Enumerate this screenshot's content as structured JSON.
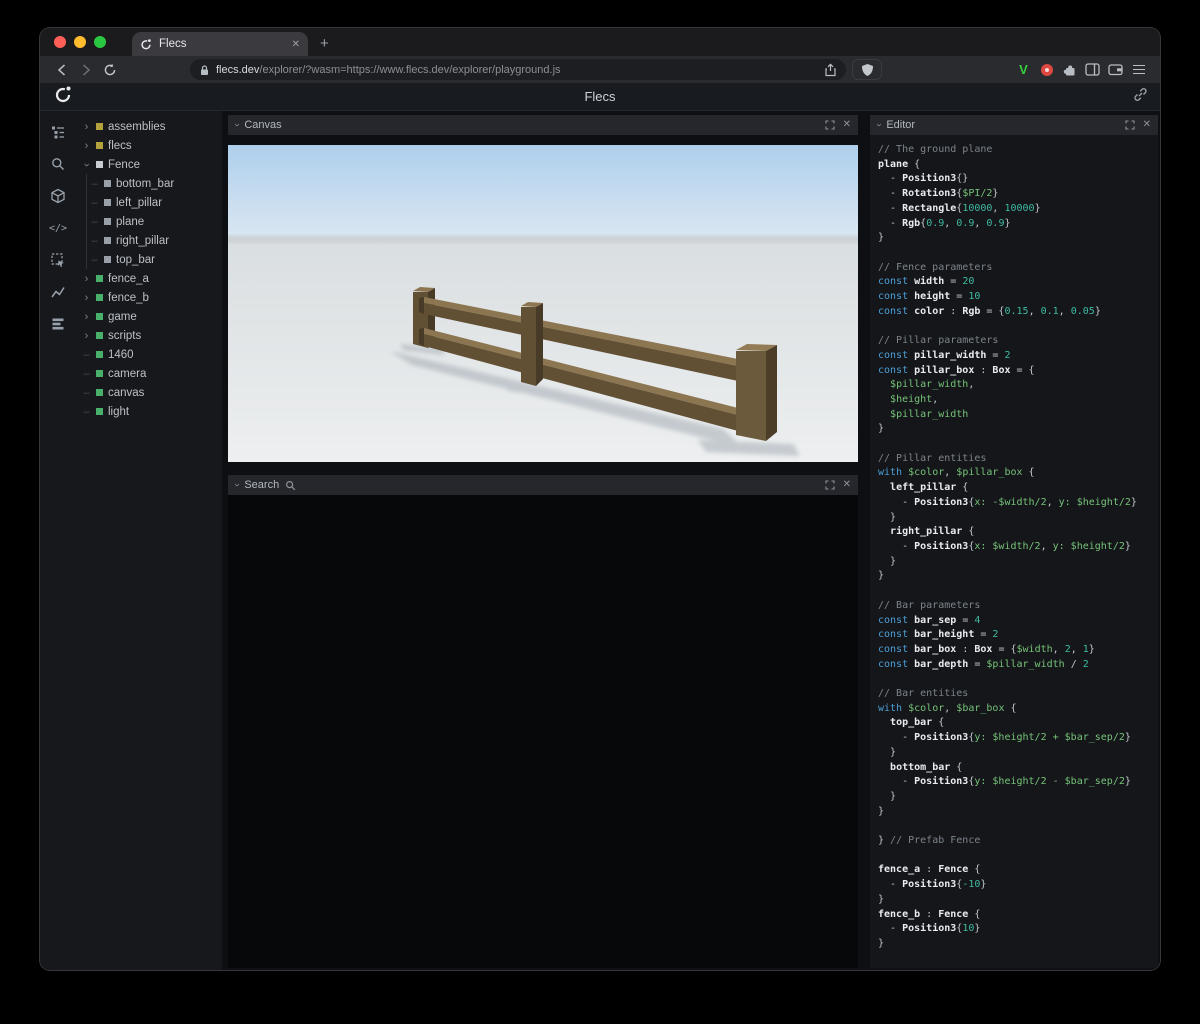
{
  "browser": {
    "tab_title": "Flecs",
    "new_tab_label": "+",
    "url_domain": "flecs.dev",
    "url_path": "/explorer/?wasm=https://www.flecs.dev/explorer/playground.js"
  },
  "header": {
    "title": "Flecs"
  },
  "panels": {
    "canvas_title": "Canvas",
    "search_title": "Search",
    "editor_title": "Editor"
  },
  "tree": {
    "items": [
      {
        "label": "assemblies",
        "sq": "#b3a23c",
        "arrow": "right",
        "depth": 0
      },
      {
        "label": "flecs",
        "sq": "#b3a23c",
        "arrow": "right",
        "depth": 0
      },
      {
        "label": "Fence",
        "sq": "#c9cdd3",
        "arrow": "down",
        "depth": 0
      },
      {
        "label": "bottom_bar",
        "sq": "#99a0a8",
        "arrow": "none",
        "depth": 1
      },
      {
        "label": "left_pillar",
        "sq": "#99a0a8",
        "arrow": "none",
        "depth": 1
      },
      {
        "label": "plane",
        "sq": "#99a0a8",
        "arrow": "none",
        "depth": 1
      },
      {
        "label": "right_pillar",
        "sq": "#99a0a8",
        "arrow": "none",
        "depth": 1
      },
      {
        "label": "top_bar",
        "sq": "#99a0a8",
        "arrow": "none",
        "depth": 1
      },
      {
        "label": "fence_a",
        "sq": "#48b06a",
        "arrow": "right",
        "depth": 0
      },
      {
        "label": "fence_b",
        "sq": "#48b06a",
        "arrow": "right",
        "depth": 0
      },
      {
        "label": "game",
        "sq": "#48b06a",
        "arrow": "right",
        "depth": 0
      },
      {
        "label": "scripts",
        "sq": "#48b06a",
        "arrow": "right",
        "depth": 0
      },
      {
        "label": "1460",
        "sq": "#48b06a",
        "arrow": "none",
        "depth": 0
      },
      {
        "label": "camera",
        "sq": "#48b06a",
        "arrow": "none",
        "depth": 0
      },
      {
        "label": "canvas",
        "sq": "#48b06a",
        "arrow": "none",
        "depth": 0
      },
      {
        "label": "light",
        "sq": "#48b06a",
        "arrow": "none",
        "depth": 0
      }
    ]
  },
  "scene": {
    "sky_top": "#aecfec",
    "sky_bottom": "#dce8f2",
    "ground_top": "#d9dee0",
    "ground_bottom": "#edeff0",
    "horizon": "#c6cdd2",
    "shadow": "#96a0a9",
    "wood_top": "#8c7551",
    "wood_front": "#625035",
    "wood_side": "#473a26",
    "wood_top_near": "#937c55",
    "wood_front_near": "#6c5a3d",
    "wood_side_near": "#4b3d28"
  },
  "editor": {
    "lines": [
      [
        [
          "cm",
          "// The ground plane"
        ]
      ],
      [
        [
          "id",
          "plane"
        ],
        [
          "pl",
          " {"
        ]
      ],
      [
        [
          "pl",
          "  - "
        ],
        [
          "id",
          "Position3"
        ],
        [
          "pl",
          "{}"
        ]
      ],
      [
        [
          "pl",
          "  - "
        ],
        [
          "id",
          "Rotation3"
        ],
        [
          "pl",
          "{"
        ],
        [
          "gr",
          "$PI/2"
        ],
        [
          "pl",
          "}"
        ]
      ],
      [
        [
          "pl",
          "  - "
        ],
        [
          "id",
          "Rectangle"
        ],
        [
          "pl",
          "{"
        ],
        [
          "nm",
          "10000"
        ],
        [
          "pl",
          ", "
        ],
        [
          "nm",
          "10000"
        ],
        [
          "pl",
          "}"
        ]
      ],
      [
        [
          "pl",
          "  - "
        ],
        [
          "id",
          "Rgb"
        ],
        [
          "pl",
          "{"
        ],
        [
          "nm",
          "0.9"
        ],
        [
          "pl",
          ", "
        ],
        [
          "nm",
          "0.9"
        ],
        [
          "pl",
          ", "
        ],
        [
          "nm",
          "0.9"
        ],
        [
          "pl",
          "}"
        ]
      ],
      [
        [
          "pl",
          "}"
        ]
      ],
      [],
      [
        [
          "cm",
          "// Fence parameters"
        ]
      ],
      [
        [
          "kw",
          "const"
        ],
        [
          "pl",
          " "
        ],
        [
          "id",
          "width"
        ],
        [
          "pl",
          " = "
        ],
        [
          "nm",
          "20"
        ]
      ],
      [
        [
          "kw",
          "const"
        ],
        [
          "pl",
          " "
        ],
        [
          "id",
          "height"
        ],
        [
          "pl",
          " = "
        ],
        [
          "nm",
          "10"
        ]
      ],
      [
        [
          "kw",
          "const"
        ],
        [
          "pl",
          " "
        ],
        [
          "id",
          "color"
        ],
        [
          "pl",
          " : "
        ],
        [
          "id",
          "Rgb"
        ],
        [
          "pl",
          " = {"
        ],
        [
          "nm",
          "0.15"
        ],
        [
          "pl",
          ", "
        ],
        [
          "nm",
          "0.1"
        ],
        [
          "pl",
          ", "
        ],
        [
          "nm",
          "0.05"
        ],
        [
          "pl",
          "}"
        ]
      ],
      [],
      [
        [
          "cm",
          "// Pillar parameters"
        ]
      ],
      [
        [
          "kw",
          "const"
        ],
        [
          "pl",
          " "
        ],
        [
          "id",
          "pillar_width"
        ],
        [
          "pl",
          " = "
        ],
        [
          "nm",
          "2"
        ]
      ],
      [
        [
          "kw",
          "const"
        ],
        [
          "pl",
          " "
        ],
        [
          "id",
          "pillar_box"
        ],
        [
          "pl",
          " : "
        ],
        [
          "id",
          "Box"
        ],
        [
          "pl",
          " = {"
        ]
      ],
      [
        [
          "pl",
          "  "
        ],
        [
          "gr",
          "$pillar_width"
        ],
        [
          "pl",
          ","
        ]
      ],
      [
        [
          "pl",
          "  "
        ],
        [
          "gr",
          "$height"
        ],
        [
          "pl",
          ","
        ]
      ],
      [
        [
          "pl",
          "  "
        ],
        [
          "gr",
          "$pillar_width"
        ]
      ],
      [
        [
          "pl",
          "}"
        ]
      ],
      [],
      [
        [
          "cm",
          "// Pillar entities"
        ]
      ],
      [
        [
          "kw",
          "with"
        ],
        [
          "pl",
          " "
        ],
        [
          "gr",
          "$color"
        ],
        [
          "pl",
          ", "
        ],
        [
          "gr",
          "$pillar_box"
        ],
        [
          "pl",
          " {"
        ]
      ],
      [
        [
          "pl",
          "  "
        ],
        [
          "id",
          "left_pillar"
        ],
        [
          "pl",
          " {"
        ]
      ],
      [
        [
          "pl",
          "    - "
        ],
        [
          "id",
          "Position3"
        ],
        [
          "pl",
          "{"
        ],
        [
          "gr",
          "x: -$width/2"
        ],
        [
          "pl",
          ", "
        ],
        [
          "gr",
          "y: $height/2"
        ],
        [
          "pl",
          "}"
        ]
      ],
      [
        [
          "pl",
          "  }"
        ]
      ],
      [
        [
          "pl",
          "  "
        ],
        [
          "id",
          "right_pillar"
        ],
        [
          "pl",
          " {"
        ]
      ],
      [
        [
          "pl",
          "    - "
        ],
        [
          "id",
          "Position3"
        ],
        [
          "pl",
          "{"
        ],
        [
          "gr",
          "x: $width/2"
        ],
        [
          "pl",
          ", "
        ],
        [
          "gr",
          "y: $height/2"
        ],
        [
          "pl",
          "}"
        ]
      ],
      [
        [
          "pl",
          "  }"
        ]
      ],
      [
        [
          "pl",
          "}"
        ]
      ],
      [],
      [
        [
          "cm",
          "// Bar parameters"
        ]
      ],
      [
        [
          "kw",
          "const"
        ],
        [
          "pl",
          " "
        ],
        [
          "id",
          "bar_sep"
        ],
        [
          "pl",
          " = "
        ],
        [
          "nm",
          "4"
        ]
      ],
      [
        [
          "kw",
          "const"
        ],
        [
          "pl",
          " "
        ],
        [
          "id",
          "bar_height"
        ],
        [
          "pl",
          " = "
        ],
        [
          "nm",
          "2"
        ]
      ],
      [
        [
          "kw",
          "const"
        ],
        [
          "pl",
          " "
        ],
        [
          "id",
          "bar_box"
        ],
        [
          "pl",
          " : "
        ],
        [
          "id",
          "Box"
        ],
        [
          "pl",
          " = {"
        ],
        [
          "gr",
          "$width"
        ],
        [
          "pl",
          ", "
        ],
        [
          "nm",
          "2"
        ],
        [
          "pl",
          ", "
        ],
        [
          "nm",
          "1"
        ],
        [
          "pl",
          "}"
        ]
      ],
      [
        [
          "kw",
          "const"
        ],
        [
          "pl",
          " "
        ],
        [
          "id",
          "bar_depth"
        ],
        [
          "pl",
          " = "
        ],
        [
          "gr",
          "$pillar_width"
        ],
        [
          "pl",
          " / "
        ],
        [
          "nm",
          "2"
        ]
      ],
      [],
      [
        [
          "cm",
          "// Bar entities"
        ]
      ],
      [
        [
          "kw",
          "with"
        ],
        [
          "pl",
          " "
        ],
        [
          "gr",
          "$color"
        ],
        [
          "pl",
          ", "
        ],
        [
          "gr",
          "$bar_box"
        ],
        [
          "pl",
          " {"
        ]
      ],
      [
        [
          "pl",
          "  "
        ],
        [
          "id",
          "top_bar"
        ],
        [
          "pl",
          " {"
        ]
      ],
      [
        [
          "pl",
          "    - "
        ],
        [
          "id",
          "Position3"
        ],
        [
          "pl",
          "{"
        ],
        [
          "gr",
          "y: $height/2 + $bar_sep/2"
        ],
        [
          "pl",
          "}"
        ]
      ],
      [
        [
          "pl",
          "  }"
        ]
      ],
      [
        [
          "pl",
          "  "
        ],
        [
          "id",
          "bottom_bar"
        ],
        [
          "pl",
          " {"
        ]
      ],
      [
        [
          "pl",
          "    - "
        ],
        [
          "id",
          "Position3"
        ],
        [
          "pl",
          "{"
        ],
        [
          "gr",
          "y: $height/2 - $bar_sep/2"
        ],
        [
          "pl",
          "}"
        ]
      ],
      [
        [
          "pl",
          "  }"
        ]
      ],
      [
        [
          "pl",
          "}"
        ]
      ],
      [],
      [
        [
          "pl",
          "} "
        ],
        [
          "cm",
          "// Prefab Fence"
        ]
      ],
      [],
      [
        [
          "id",
          "fence_a"
        ],
        [
          "pl",
          " : "
        ],
        [
          "id",
          "Fence"
        ],
        [
          "pl",
          " {"
        ]
      ],
      [
        [
          "pl",
          "  - "
        ],
        [
          "id",
          "Position3"
        ],
        [
          "pl",
          "{"
        ],
        [
          "nm",
          "-10"
        ],
        [
          "pl",
          "}"
        ]
      ],
      [
        [
          "pl",
          "}"
        ]
      ],
      [
        [
          "id",
          "fence_b"
        ],
        [
          "pl",
          " : "
        ],
        [
          "id",
          "Fence"
        ],
        [
          "pl",
          " {"
        ]
      ],
      [
        [
          "pl",
          "  - "
        ],
        [
          "id",
          "Position3"
        ],
        [
          "pl",
          "{"
        ],
        [
          "nm",
          "10"
        ],
        [
          "pl",
          "}"
        ]
      ],
      [
        [
          "pl",
          "}"
        ]
      ]
    ]
  }
}
